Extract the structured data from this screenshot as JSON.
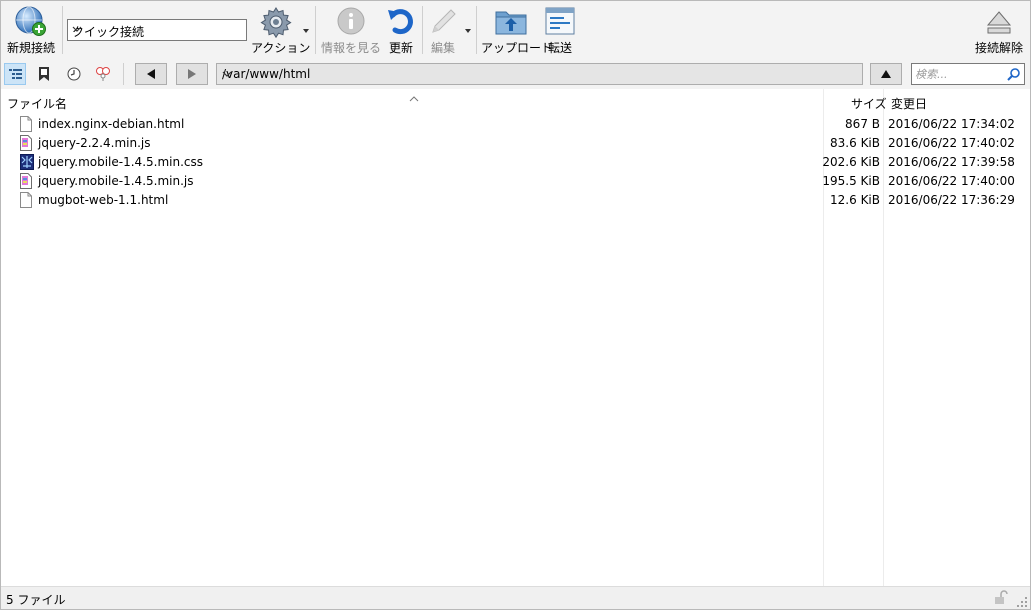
{
  "toolbar": {
    "new_connection": "新規接続",
    "quick_connect": "クイック接続",
    "action": "アクション",
    "get_info": "情報を見る",
    "refresh": "更新",
    "edit": "編集",
    "upload": "アップロード",
    "transfer": "転送",
    "disconnect": "接続解除"
  },
  "nav": {
    "path": "/var/www/html",
    "search_placeholder": "検索..."
  },
  "columns": {
    "filename": "ファイル名",
    "size": "サイズ",
    "modified": "変更日"
  },
  "files": [
    {
      "name": "index.nginx-debian.html",
      "size": "867 B",
      "modified": "2016/06/22 17:34:02",
      "icon": "html-file-icon"
    },
    {
      "name": "jquery-2.2.4.min.js",
      "size": "83.6 KiB",
      "modified": "2016/06/22 17:40:02",
      "icon": "js-file-icon"
    },
    {
      "name": "jquery.mobile-1.4.5.min.css",
      "size": "202.6 KiB",
      "modified": "2016/06/22 17:39:58",
      "icon": "css-file-icon"
    },
    {
      "name": "jquery.mobile-1.4.5.min.js",
      "size": "195.5 KiB",
      "modified": "2016/06/22 17:40:00",
      "icon": "js-file-icon"
    },
    {
      "name": "mugbot-web-1.1.html",
      "size": "12.6 KiB",
      "modified": "2016/06/22 17:36:29",
      "icon": "html-file-icon"
    }
  ],
  "status": {
    "count": "5 ファイル"
  }
}
